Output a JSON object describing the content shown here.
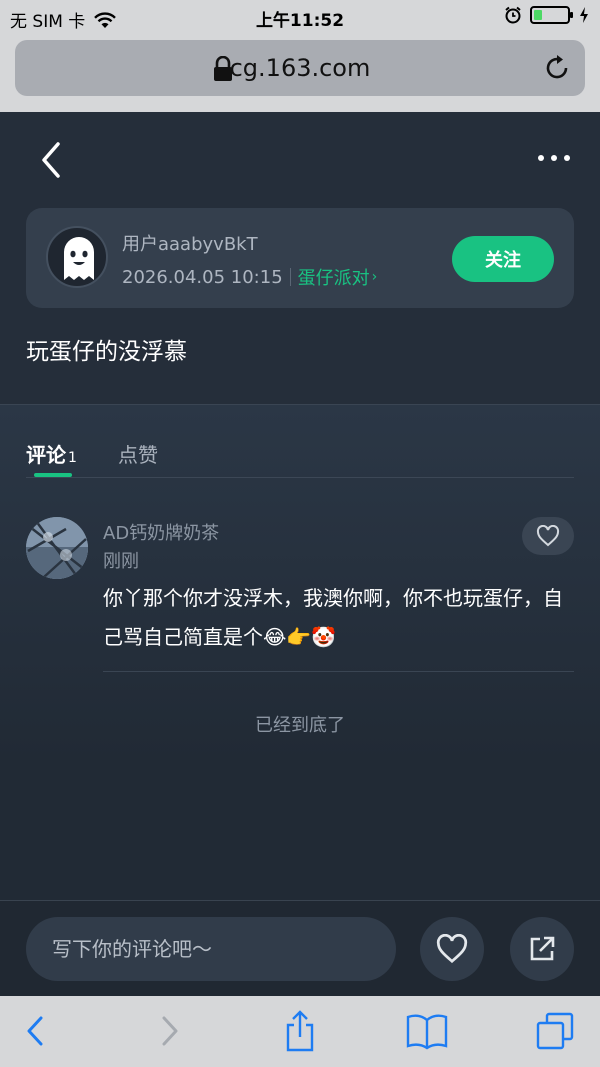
{
  "status_bar": {
    "carrier": "无 SIM 卡",
    "time": "上午11:52",
    "battery_level": 0.25
  },
  "browser": {
    "url": "cg.163.com"
  },
  "author": {
    "username": "用户aaabyvBkT",
    "timestamp": "2026.04.05 10:15",
    "tag": "蛋仔派对",
    "tag_arrow": "›",
    "follow_label": "关注"
  },
  "post": {
    "title": "玩蛋仔的没浮慕"
  },
  "tabs": [
    {
      "label": "评论",
      "count": "1"
    },
    {
      "label": "点赞"
    }
  ],
  "comments": [
    {
      "name": "AD钙奶牌奶茶",
      "time": "刚刚",
      "text": "你丫那个你才没浮木，我澳你啊，你不也玩蛋仔，自己骂自己简直是个😂👉🤡"
    }
  ],
  "end_text": "已经到底了",
  "comment_input": {
    "placeholder": "写下你的评论吧～"
  },
  "colors": {
    "accent": "#19c282",
    "background": "#252e3a"
  },
  "icons": [
    "back-icon",
    "more-icon",
    "lock-icon",
    "reload-icon",
    "heart-icon",
    "share-icon",
    "chevron-left-icon",
    "chevron-right-icon",
    "upload-icon",
    "bookmarks-icon",
    "tabs-icon",
    "wifi-icon",
    "alarm-icon",
    "charging-icon"
  ]
}
